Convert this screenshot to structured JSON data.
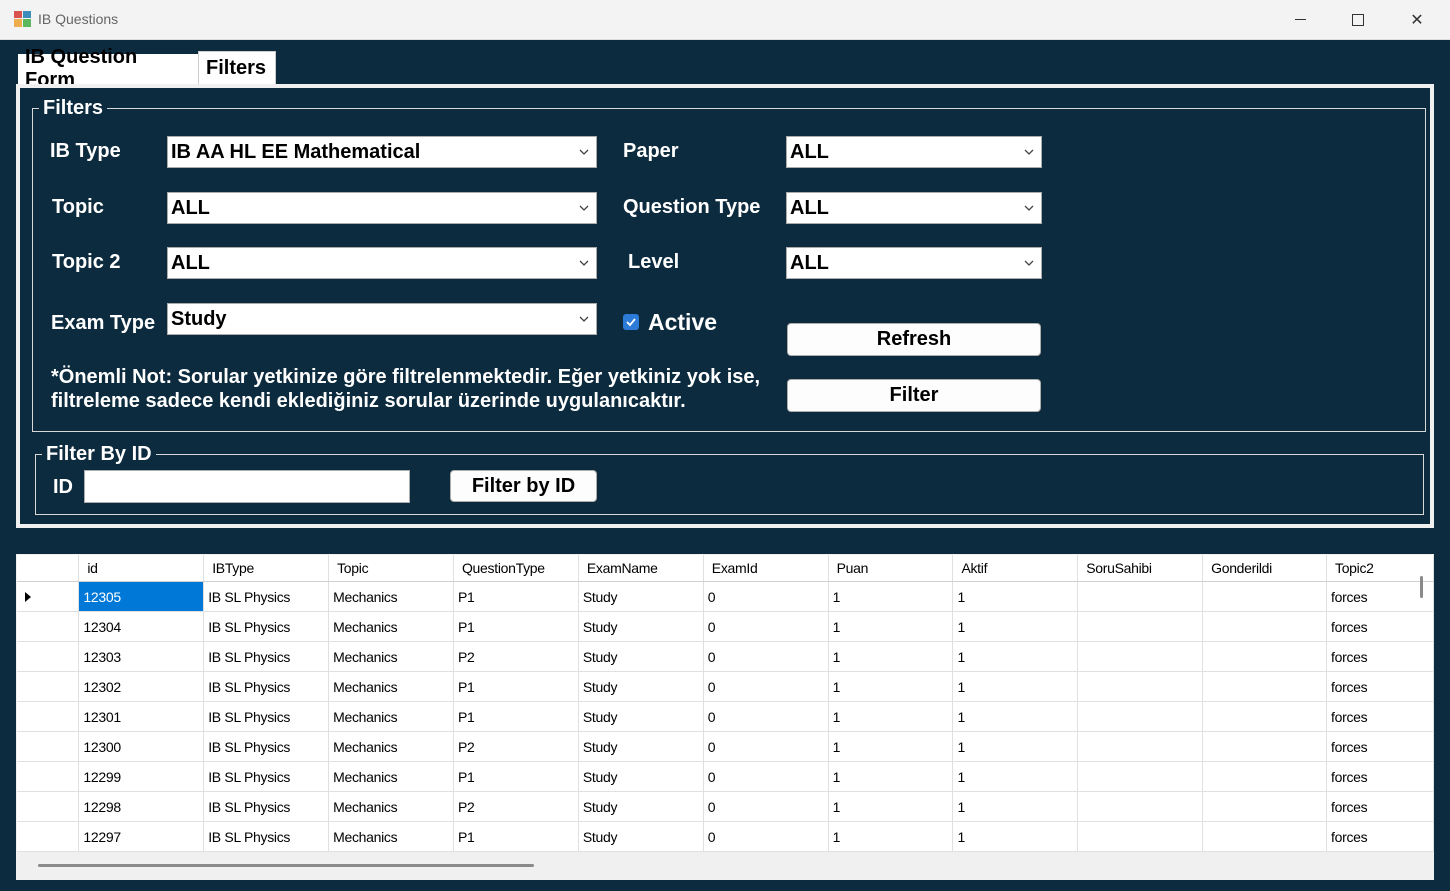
{
  "window": {
    "title": "IB Questions",
    "icons": {
      "app": "app-form-icon",
      "minimize": "minimize-icon",
      "maximize": "maximize-icon",
      "close": "close-icon"
    },
    "close_glyph": "✕"
  },
  "tabs": [
    {
      "label": "IB Question Form",
      "active": false
    },
    {
      "label": "Filters",
      "active": true
    }
  ],
  "filters": {
    "group_title": "Filters",
    "ib_type": {
      "label": "IB Type",
      "value": "IB AA HL EE Mathematical"
    },
    "topic": {
      "label": "Topic",
      "value": "ALL"
    },
    "topic2": {
      "label": "Topic 2",
      "value": "ALL"
    },
    "exam_type": {
      "label": "Exam Type",
      "value": "Study"
    },
    "paper": {
      "label": "Paper",
      "value": "ALL"
    },
    "question_type": {
      "label": "Question Type",
      "value": "ALL"
    },
    "level": {
      "label": "Level",
      "value": "ALL"
    },
    "active": {
      "label": "Active",
      "checked": true
    },
    "refresh_label": "Refresh",
    "filter_label": "Filter",
    "note_line1": "*Önemli Not: Sorular yetkinize göre filtrelenmektedir. Eğer yetkiniz yok ise,",
    "note_line2": "filtreleme sadece kendi eklediğiniz sorular üzerinde uygulanıcaktır."
  },
  "filter_by_id": {
    "group_title": "Filter By ID",
    "id_label": "ID",
    "id_value": "",
    "button_label": "Filter by ID"
  },
  "grid": {
    "columns": [
      "id",
      "IBType",
      "Topic",
      "QuestionType",
      "ExamName",
      "ExamId",
      "Puan",
      "Aktif",
      "SoruSahibi",
      "Gonderildi",
      "Topic2"
    ],
    "rows": [
      [
        "12305",
        "IB SL Physics",
        "Mechanics",
        "P1",
        "Study",
        "0",
        "1",
        "1",
        "",
        "",
        "forces"
      ],
      [
        "12304",
        "IB SL Physics",
        "Mechanics",
        "P1",
        "Study",
        "0",
        "1",
        "1",
        "",
        "",
        "forces"
      ],
      [
        "12303",
        "IB SL Physics",
        "Mechanics",
        "P2",
        "Study",
        "0",
        "1",
        "1",
        "",
        "",
        "forces"
      ],
      [
        "12302",
        "IB SL Physics",
        "Mechanics",
        "P1",
        "Study",
        "0",
        "1",
        "1",
        "",
        "",
        "forces"
      ],
      [
        "12301",
        "IB SL Physics",
        "Mechanics",
        "P1",
        "Study",
        "0",
        "1",
        "1",
        "",
        "",
        "forces"
      ],
      [
        "12300",
        "IB SL Physics",
        "Mechanics",
        "P2",
        "Study",
        "0",
        "1",
        "1",
        "",
        "",
        "forces"
      ],
      [
        "12299",
        "IB SL Physics",
        "Mechanics",
        "P1",
        "Study",
        "0",
        "1",
        "1",
        "",
        "",
        "forces"
      ],
      [
        "12298",
        "IB SL Physics",
        "Mechanics",
        "P2",
        "Study",
        "0",
        "1",
        "1",
        "",
        "",
        "forces"
      ],
      [
        "12297",
        "IB SL Physics",
        "Mechanics",
        "P1",
        "Study",
        "0",
        "1",
        "1",
        "",
        "",
        "forces"
      ]
    ],
    "selected_cell": {
      "row": 0,
      "col": 0
    }
  },
  "colors": {
    "background": "#0d2b3e",
    "selection": "#0078d7",
    "checkbox": "#2d7bd8"
  }
}
